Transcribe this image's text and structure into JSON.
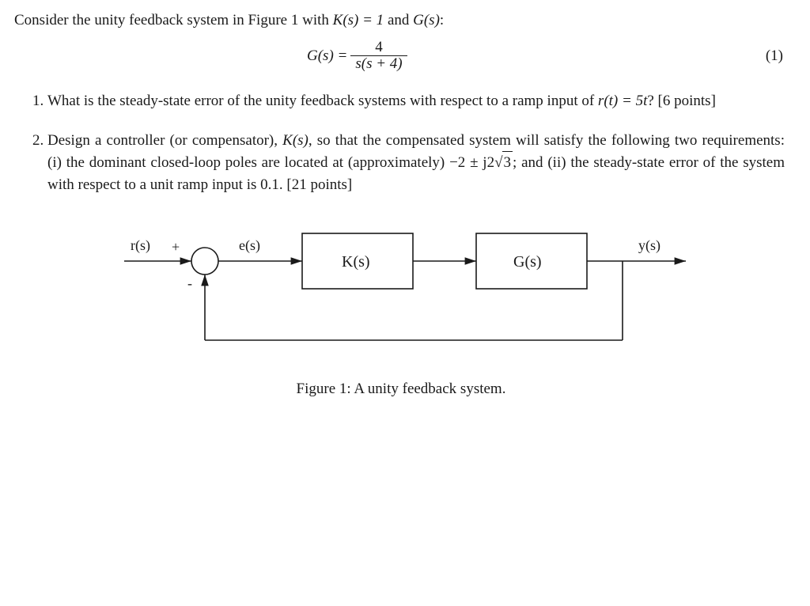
{
  "intro": {
    "pre": "Consider the unity feedback system in Figure 1 with ",
    "K_eq": "K(s) = 1",
    "mid": " and ",
    "G_sym": "G(s)",
    "post": ":"
  },
  "equation": {
    "lhs": "G(s) = ",
    "numerator": "4",
    "den_left": "s",
    "den_paren": "(s + 4)",
    "tag": "(1)"
  },
  "q1": {
    "a": "What is the steady-state error of the unity feedback systems with respect to a ramp input of ",
    "b": "r(t) = 5t",
    "c": "? [6 points]"
  },
  "q2": {
    "a": "Design a controller (or compensator), ",
    "b": "K(s)",
    "c": ", so that the compensated system will satisfy the following two requirements: (i) the dominant closed-loop poles are located at (approximately) ",
    "d_pre": "−2 ± j2",
    "d_rad": "3",
    "e": "; and (ii) the steady-state error of the system with respect to a unit ramp input is 0.1. [21 points]"
  },
  "fig": {
    "r": "r(s)",
    "plus": "+",
    "minus": "-",
    "e": "e(s)",
    "K": "K(s)",
    "G": "G(s)",
    "y": "y(s)",
    "caption": "Figure 1: A unity feedback system."
  }
}
